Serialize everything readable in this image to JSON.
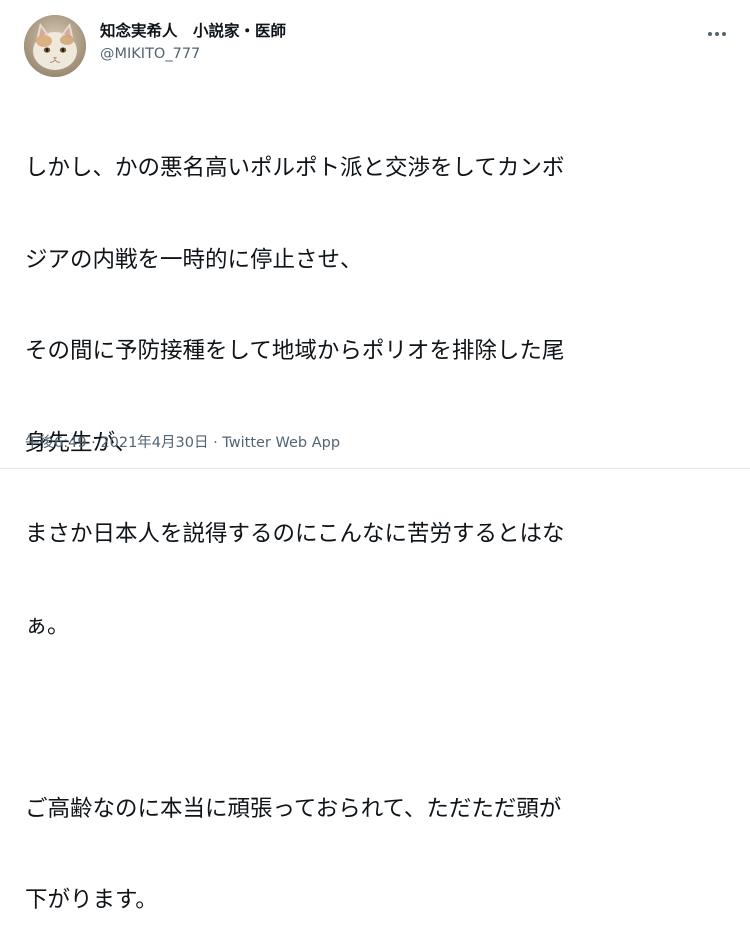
{
  "author": {
    "display_name": "知念実希人　小説家・医師",
    "handle": "@MIKITO_777"
  },
  "more_icon": "more-dots-icon",
  "tweet": {
    "lines": [
      "しかし、かの悪名高いポルポト派と交渉をしてカンボ",
      "ジアの内戦を一時的に停止させ、",
      "その間に予防接種をして地域からポリオを排除した尾",
      "身先生が、",
      "まさか日本人を説得するのにこんなに苦労するとはな",
      "ぁ。",
      "",
      "ご高齢なのに本当に頑張っておられて、ただただ頭が",
      "下がります。"
    ]
  },
  "meta": {
    "time": "午後6:49",
    "separator_1": " · ",
    "date": "2021年4月30日",
    "separator_2": " · ",
    "source": "Twitter Web App"
  },
  "colors": {
    "text": "#0f1419",
    "secondary": "#536471",
    "background": "#ffffff"
  }
}
